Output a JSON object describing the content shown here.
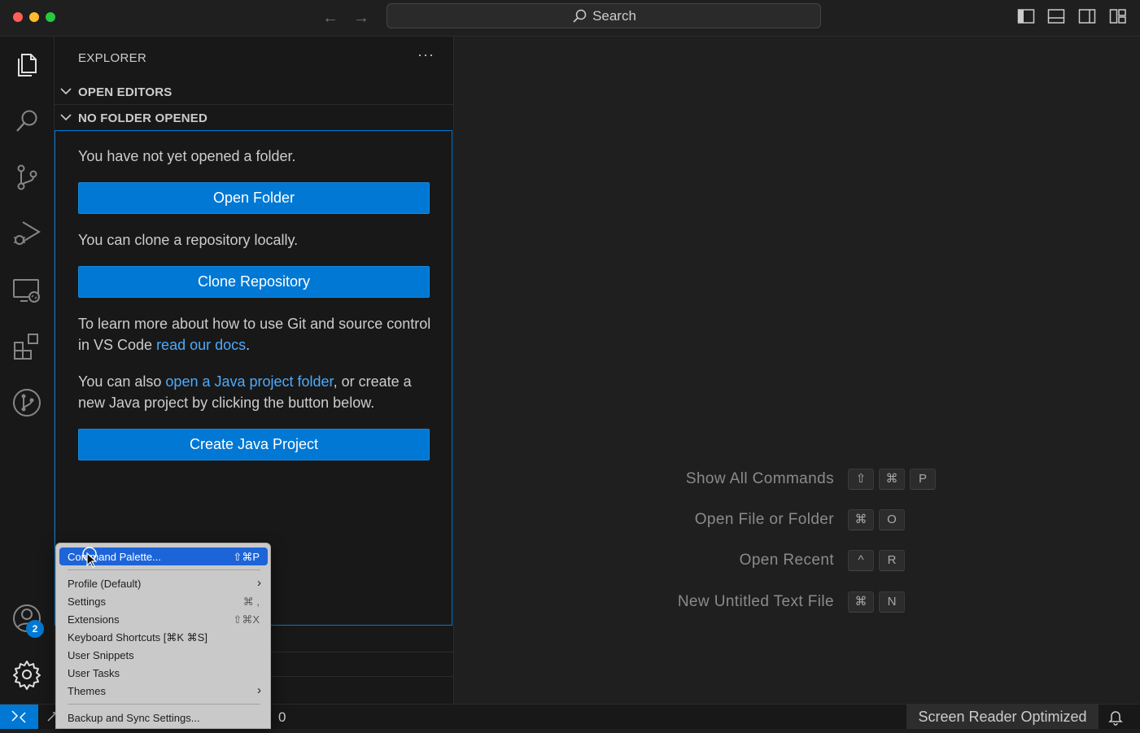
{
  "titlebar": {
    "search_label": "Search"
  },
  "sidebar": {
    "title": "EXPLORER",
    "sections": {
      "open_editors": "OPEN EDITORS",
      "no_folder": "NO FOLDER OPENED"
    },
    "messages": {
      "not_opened": "You have not yet opened a folder.",
      "clone": "You can clone a repository locally.",
      "git_prefix": "To learn more about how to use Git and source control in VS Code ",
      "git_link": "read our docs",
      "git_suffix": ".",
      "java_prefix": "You can also ",
      "java_link": "open a Java project folder",
      "java_suffix": ", or create a new Java project by clicking the button below."
    },
    "buttons": {
      "open_folder": "Open Folder",
      "clone_repo": "Clone Repository",
      "create_java": "Create Java Project"
    }
  },
  "activitybar": {
    "accounts_badge": "2"
  },
  "editor": {
    "hints": [
      {
        "label": "Show All Commands",
        "keys": [
          "⇧",
          "⌘",
          "P"
        ]
      },
      {
        "label": "Open File or Folder",
        "keys": [
          "⌘",
          "O"
        ]
      },
      {
        "label": "Open Recent",
        "keys": [
          "^",
          "R"
        ]
      },
      {
        "label": "New Untitled Text File",
        "keys": [
          "⌘",
          "N"
        ]
      }
    ]
  },
  "statusbar": {
    "problems_count": "0",
    "screen_reader": "Screen Reader Optimized"
  },
  "menu": {
    "items": [
      {
        "label": "Command Palette...",
        "shortcut": "⇧⌘P"
      },
      {
        "label": "Profile (Default)",
        "shortcut": ""
      },
      {
        "label": "Settings",
        "shortcut": "⌘ ,"
      },
      {
        "label": "Extensions",
        "shortcut": "⇧⌘X"
      },
      {
        "label": "Keyboard Shortcuts [⌘K ⌘S]",
        "shortcut": ""
      },
      {
        "label": "User Snippets",
        "shortcut": ""
      },
      {
        "label": "User Tasks",
        "shortcut": ""
      },
      {
        "label": "Themes",
        "shortcut": ""
      },
      {
        "label": "Backup and Sync Settings...",
        "shortcut": ""
      }
    ]
  },
  "colors": {
    "accent": "#0078d4",
    "link": "#4daafc",
    "menu_active": "#1d64d8"
  }
}
